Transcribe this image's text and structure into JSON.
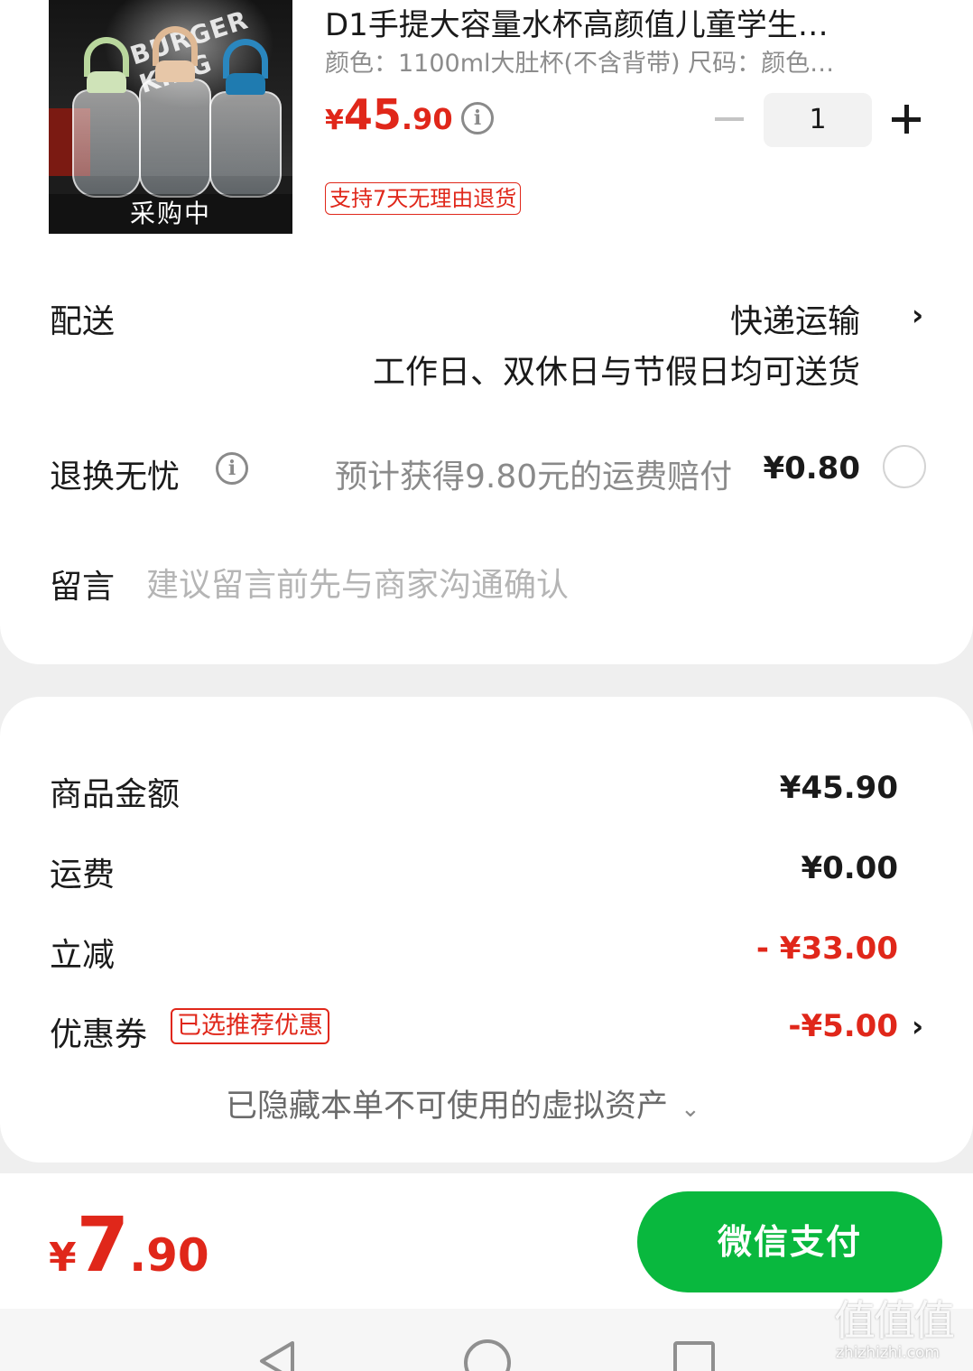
{
  "product": {
    "title": "D1手提大容量水杯高颜值儿童学生…",
    "spec": "颜色：1100ml大肚杯(不含背带)  尺码：颜色…",
    "price_yen": "¥",
    "price_int": "45",
    "price_dec": ".90",
    "image_overlay": "采购中",
    "image_logo": "BURGER KING",
    "quantity": "1",
    "return_tag": "支持7天无理由退货"
  },
  "delivery": {
    "label": "配送",
    "method": "快递运输",
    "note": "工作日、双休日与节假日均可送货"
  },
  "return_insurance": {
    "label": "退换无忧",
    "desc": "预计获得9.80元的运费赔付",
    "price": "¥0.80",
    "selected": false
  },
  "message": {
    "label": "留言",
    "placeholder": "建议留言前先与商家沟通确认"
  },
  "summary": {
    "goods_label": "商品金额",
    "goods_value": "¥45.90",
    "shipping_label": "运费",
    "shipping_value": "¥0.00",
    "discount_label": "立减",
    "discount_value": "- ¥33.00",
    "coupon_label": "优惠券",
    "coupon_tag": "已选推荐优惠",
    "coupon_value": "-¥5.00",
    "hidden_assets": "已隐藏本单不可使用的虚拟资产"
  },
  "checkout": {
    "total_yen": "¥",
    "total_int": "7",
    "total_dec": ".90",
    "pay_label": "微信支付"
  },
  "watermark": {
    "logo": "值值值",
    "url": "zhizhizhi.com"
  },
  "colors": {
    "accent_red": "#e0271a",
    "pay_green": "#09b83e",
    "background": "#efefef"
  },
  "icons": {
    "info": "info-icon",
    "chevron": "chevron-right-icon",
    "caret": "chevron-down-icon"
  }
}
